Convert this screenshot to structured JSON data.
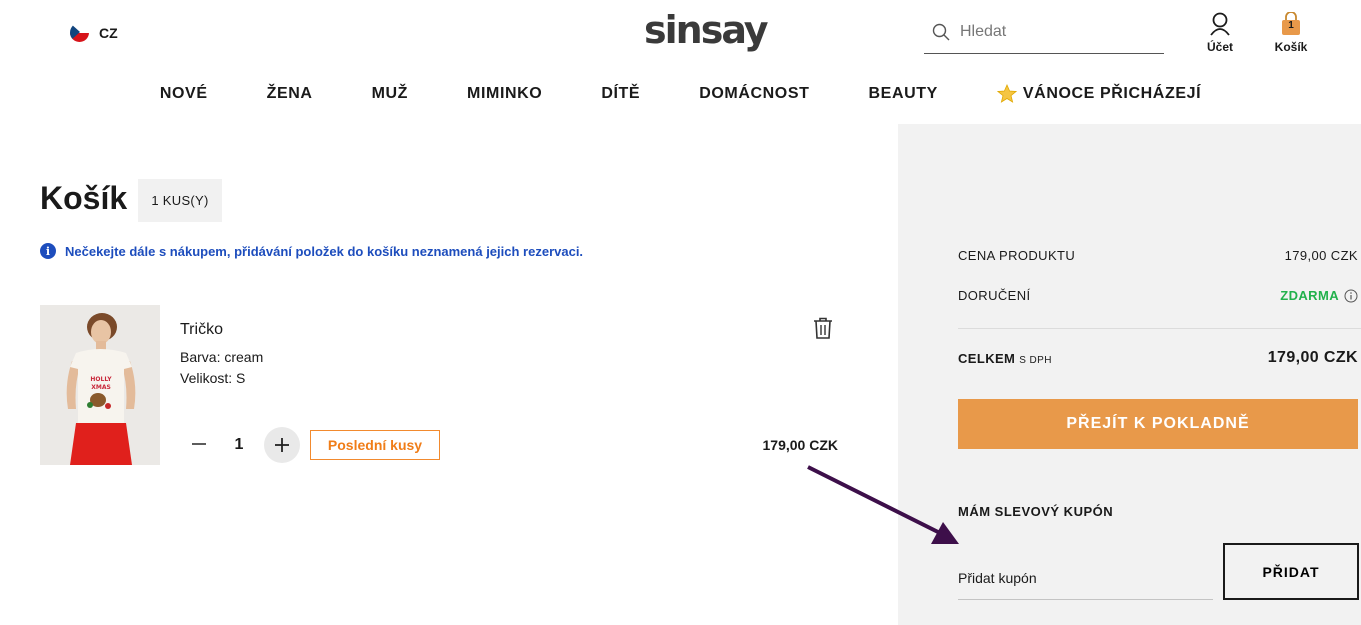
{
  "header": {
    "country_code": "CZ",
    "logo": "sinsay",
    "search": {
      "placeholder": "Hledat",
      "value": ""
    },
    "account_label": "Účet",
    "cart_label": "Košík",
    "cart_count": "1"
  },
  "nav": {
    "items": [
      {
        "label": "NOVÉ"
      },
      {
        "label": "ŽENA"
      },
      {
        "label": "MUŽ"
      },
      {
        "label": "MIMINKO"
      },
      {
        "label": "DÍTĚ"
      },
      {
        "label": "DOMÁCNOST"
      },
      {
        "label": "BEAUTY"
      },
      {
        "label": "VÁNOCE PŘICHÁZEJÍ",
        "icon": "star-icon"
      }
    ]
  },
  "cart": {
    "title": "Košík",
    "count_badge": "1 KUS(Y)",
    "notice": "Nečekejte dále s nákupem, přidávání položek do košíku neznamená jejich rezervaci.",
    "item": {
      "name": "Tričko",
      "color_line": "Barva: cream",
      "size_line": "Velikost: S",
      "quantity": "1",
      "badge": "Poslední kusy",
      "price": "179,00 CZK"
    }
  },
  "summary": {
    "product_price_label": "CENA PRODUKTU",
    "product_price_value": "179,00 CZK",
    "delivery_label": "DORUČENÍ",
    "delivery_value": "ZDARMA",
    "total_label": "CELKEM",
    "total_suffix": "S DPH",
    "total_value": "179,00 CZK",
    "checkout_label": "PŘEJÍT K POKLADNĚ",
    "coupon_title": "MÁM SLEVOVÝ KUPÓN",
    "coupon_placeholder": "Přidat kupón",
    "coupon_button": "PŘIDAT"
  },
  "colors": {
    "accent_orange": "#e8994a",
    "badge_orange": "#f07d18",
    "info_blue": "#1d4dbd",
    "free_green": "#22b14c",
    "annotation_arrow": "#3d0f4a"
  }
}
